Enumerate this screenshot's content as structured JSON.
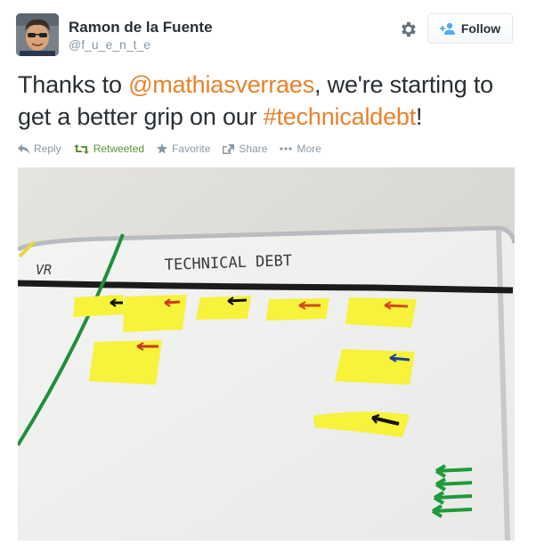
{
  "user": {
    "name": "Ramon de la Fuente",
    "handle": "@f_u_e_n_t_e"
  },
  "follow_label": "Follow",
  "tweet": {
    "part1": "Thanks to ",
    "mention": "@mathiasverraes",
    "part2": ", we're starting to get a better grip on our ",
    "hashtag": "#technicaldebt",
    "part3": "!"
  },
  "actions": {
    "reply": "Reply",
    "retweeted": "Retweeted",
    "favorite": "Favorite",
    "share": "Share",
    "more": "More"
  },
  "photo": {
    "board_heading": "TECHNICAL DEBT",
    "column_label": "VR"
  },
  "colors": {
    "accent": "#e8822a",
    "retweet": "#5c913b",
    "muted": "#8899a6",
    "sticky_note": "#f7f23a"
  }
}
